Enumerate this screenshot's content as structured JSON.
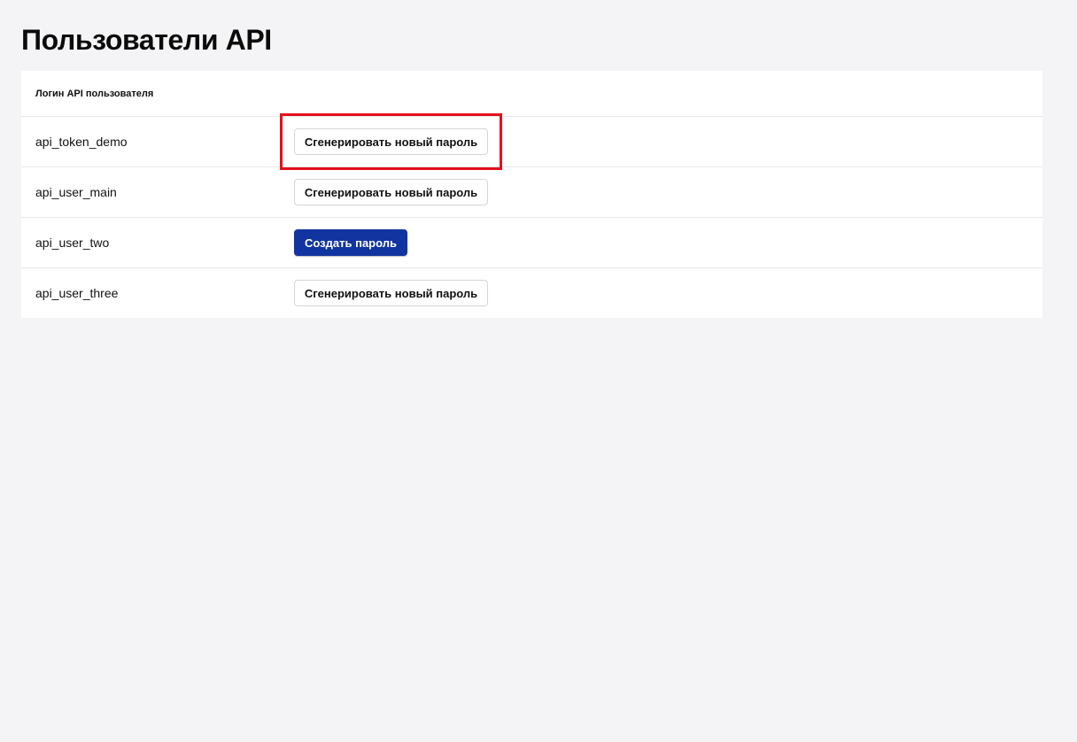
{
  "page": {
    "title": "Пользователи API"
  },
  "table": {
    "header": {
      "login_label": "Логин API пользователя"
    },
    "rows": [
      {
        "login": "api_token_demo",
        "action_label": "Сгенерировать новый пароль",
        "action_type": "outline"
      },
      {
        "login": "api_user_main",
        "action_label": "Сгенерировать новый пароль",
        "action_type": "outline"
      },
      {
        "login": "api_user_two",
        "action_label": "Создать пароль",
        "action_type": "primary"
      },
      {
        "login": "api_user_three",
        "action_label": "Сгенерировать новый пароль",
        "action_type": "outline"
      }
    ]
  },
  "colors": {
    "background": "#f4f4f6",
    "primary_button": "#1234a0",
    "highlight": "#e3111b"
  }
}
